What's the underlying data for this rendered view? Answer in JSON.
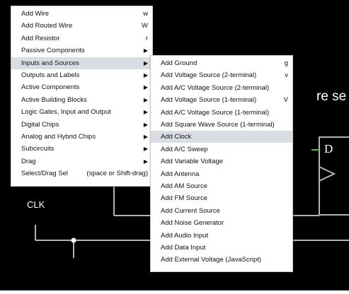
{
  "canvas": {
    "background": "#000000",
    "wire_color": "#b3b3b3",
    "highlight_wire_color": "#33cc33",
    "label_clk": "CLK",
    "label_d": "D",
    "partial_title": "re se"
  },
  "main_menu": {
    "items": [
      {
        "label": "Add Wire",
        "shortcut": "w",
        "submenu": false
      },
      {
        "label": "Add Routed Wire",
        "shortcut": "W",
        "submenu": false
      },
      {
        "label": "Add Resistor",
        "shortcut": "r",
        "submenu": false
      },
      {
        "label": "Passive Components",
        "shortcut": "",
        "submenu": true
      },
      {
        "label": "Inputs and Sources",
        "shortcut": "",
        "submenu": true,
        "highlighted": true
      },
      {
        "label": "Outputs and Labels",
        "shortcut": "",
        "submenu": true
      },
      {
        "label": "Active Components",
        "shortcut": "",
        "submenu": true
      },
      {
        "label": "Active Building Blocks",
        "shortcut": "",
        "submenu": true
      },
      {
        "label": "Logic Gates, Input and Output",
        "shortcut": "",
        "submenu": true
      },
      {
        "label": "Digital Chips",
        "shortcut": "",
        "submenu": true
      },
      {
        "label": "Analog and Hybrid Chips",
        "shortcut": "",
        "submenu": true
      },
      {
        "label": "Subcircuits",
        "shortcut": "",
        "submenu": true
      },
      {
        "label": "Drag",
        "shortcut": "",
        "submenu": true
      },
      {
        "label": "Select/Drag Sel",
        "shortcut": "(space or Shift-drag)",
        "submenu": false
      }
    ]
  },
  "sub_menu": {
    "items": [
      {
        "label": "Add Ground",
        "shortcut": "g"
      },
      {
        "label": "Add Voltage Source (2-terminal)",
        "shortcut": "v"
      },
      {
        "label": "Add A/C Voltage Source (2-terminal)",
        "shortcut": ""
      },
      {
        "label": "Add Voltage Source (1-terminal)",
        "shortcut": "V"
      },
      {
        "label": "Add A/C Voltage Source (1-terminal)",
        "shortcut": ""
      },
      {
        "label": "Add Square Wave Source (1-terminal)",
        "shortcut": ""
      },
      {
        "label": "Add Clock",
        "shortcut": "",
        "highlighted": true
      },
      {
        "label": "Add A/C Sweep",
        "shortcut": ""
      },
      {
        "label": "Add Variable Voltage",
        "shortcut": ""
      },
      {
        "label": "Add Antenna",
        "shortcut": ""
      },
      {
        "label": "Add AM Source",
        "shortcut": ""
      },
      {
        "label": "Add FM Source",
        "shortcut": ""
      },
      {
        "label": "Add Current Source",
        "shortcut": ""
      },
      {
        "label": "Add Noise Generator",
        "shortcut": ""
      },
      {
        "label": "Add Audio Input",
        "shortcut": ""
      },
      {
        "label": "Add Data Input",
        "shortcut": ""
      },
      {
        "label": "Add External Voltage (JavaScript)",
        "shortcut": ""
      }
    ]
  }
}
